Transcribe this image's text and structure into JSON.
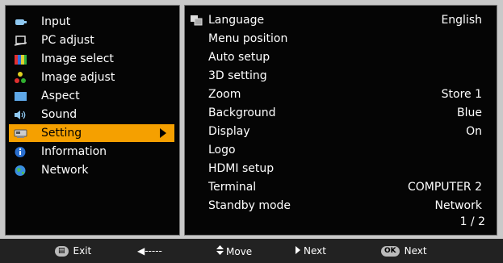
{
  "left_menu": [
    {
      "label": "Input",
      "icon": "input-icon"
    },
    {
      "label": "PC adjust",
      "icon": "pc-adjust-icon"
    },
    {
      "label": "Image select",
      "icon": "image-select-icon"
    },
    {
      "label": "Image adjust",
      "icon": "image-adjust-icon"
    },
    {
      "label": "Aspect",
      "icon": "aspect-icon"
    },
    {
      "label": "Sound",
      "icon": "speaker-icon"
    },
    {
      "label": "Setting",
      "icon": "setting-icon"
    },
    {
      "label": "Information",
      "icon": "info-icon"
    },
    {
      "label": "Network",
      "icon": "globe-icon"
    }
  ],
  "settings": [
    {
      "label": "Language",
      "value": "English"
    },
    {
      "label": "Menu position",
      "value": ""
    },
    {
      "label": "Auto setup",
      "value": ""
    },
    {
      "label": "3D setting",
      "value": ""
    },
    {
      "label": "Zoom",
      "value": "Store 1"
    },
    {
      "label": "Background",
      "value": "Blue"
    },
    {
      "label": "Display",
      "value": "On"
    },
    {
      "label": "Logo",
      "value": ""
    },
    {
      "label": "HDMI setup",
      "value": ""
    },
    {
      "label": "Terminal",
      "value": "COMPUTER 2"
    },
    {
      "label": "Standby mode",
      "value": "Network"
    }
  ],
  "page_indicator": "1 / 2",
  "bottom_bar": {
    "exit_key": "▤",
    "exit_label": "Exit",
    "back_label": "◀-----",
    "move_label": "Move",
    "next_label": "Next",
    "ok_key": "OK",
    "ok_label": "Next"
  },
  "colors": {
    "selected": "#f5a000",
    "panel_bg": "#050505",
    "frame_bg": "#c9c9c9"
  }
}
